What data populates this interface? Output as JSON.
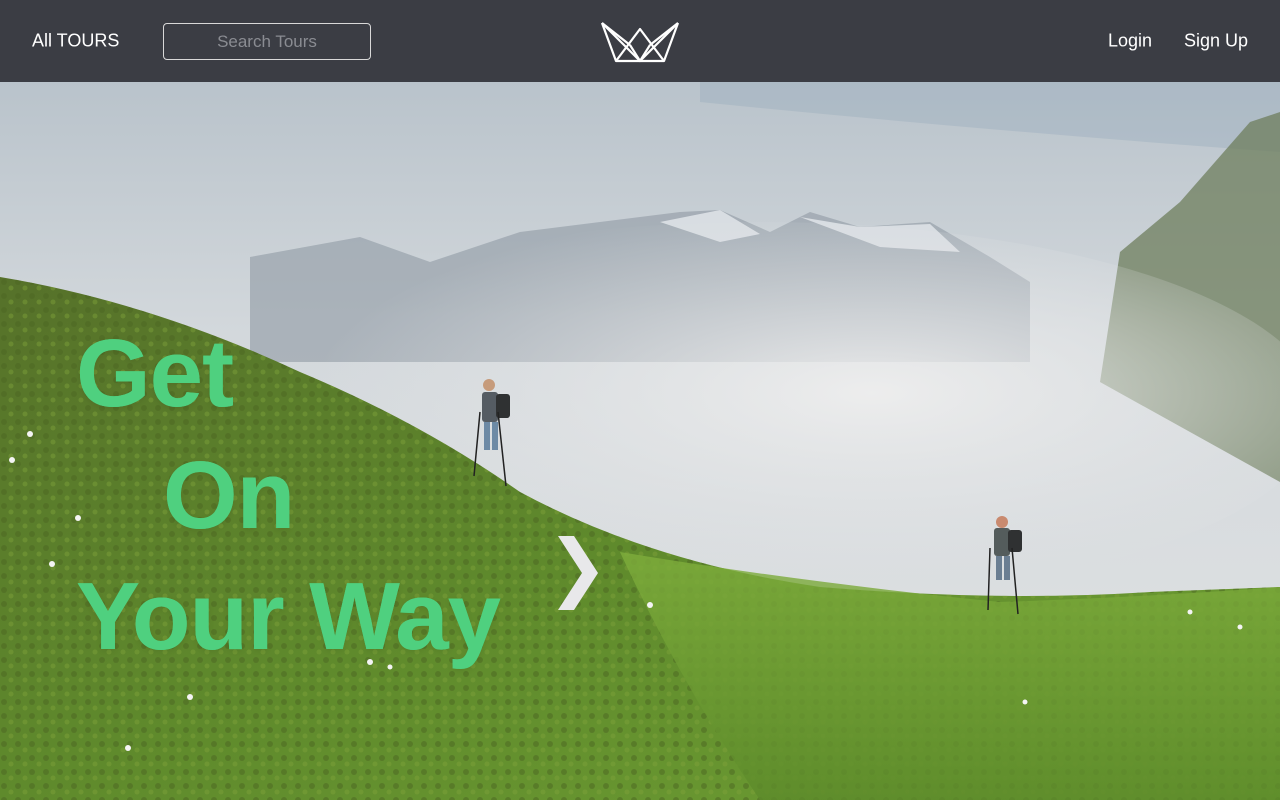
{
  "nav": {
    "all_tours_label": "All TOURS",
    "search_placeholder": "Search Tours",
    "logo_icon": "crown-logo-icon",
    "login_label": "Login",
    "signup_label": "Sign Up"
  },
  "hero": {
    "headline": [
      "Get",
      "On",
      "Your Way"
    ],
    "next_icon": "chevron-right-icon"
  },
  "colors": {
    "navbar_bg": "#3b3d44",
    "headline_green": "#4fd07f",
    "nav_text": "#ffffff"
  }
}
